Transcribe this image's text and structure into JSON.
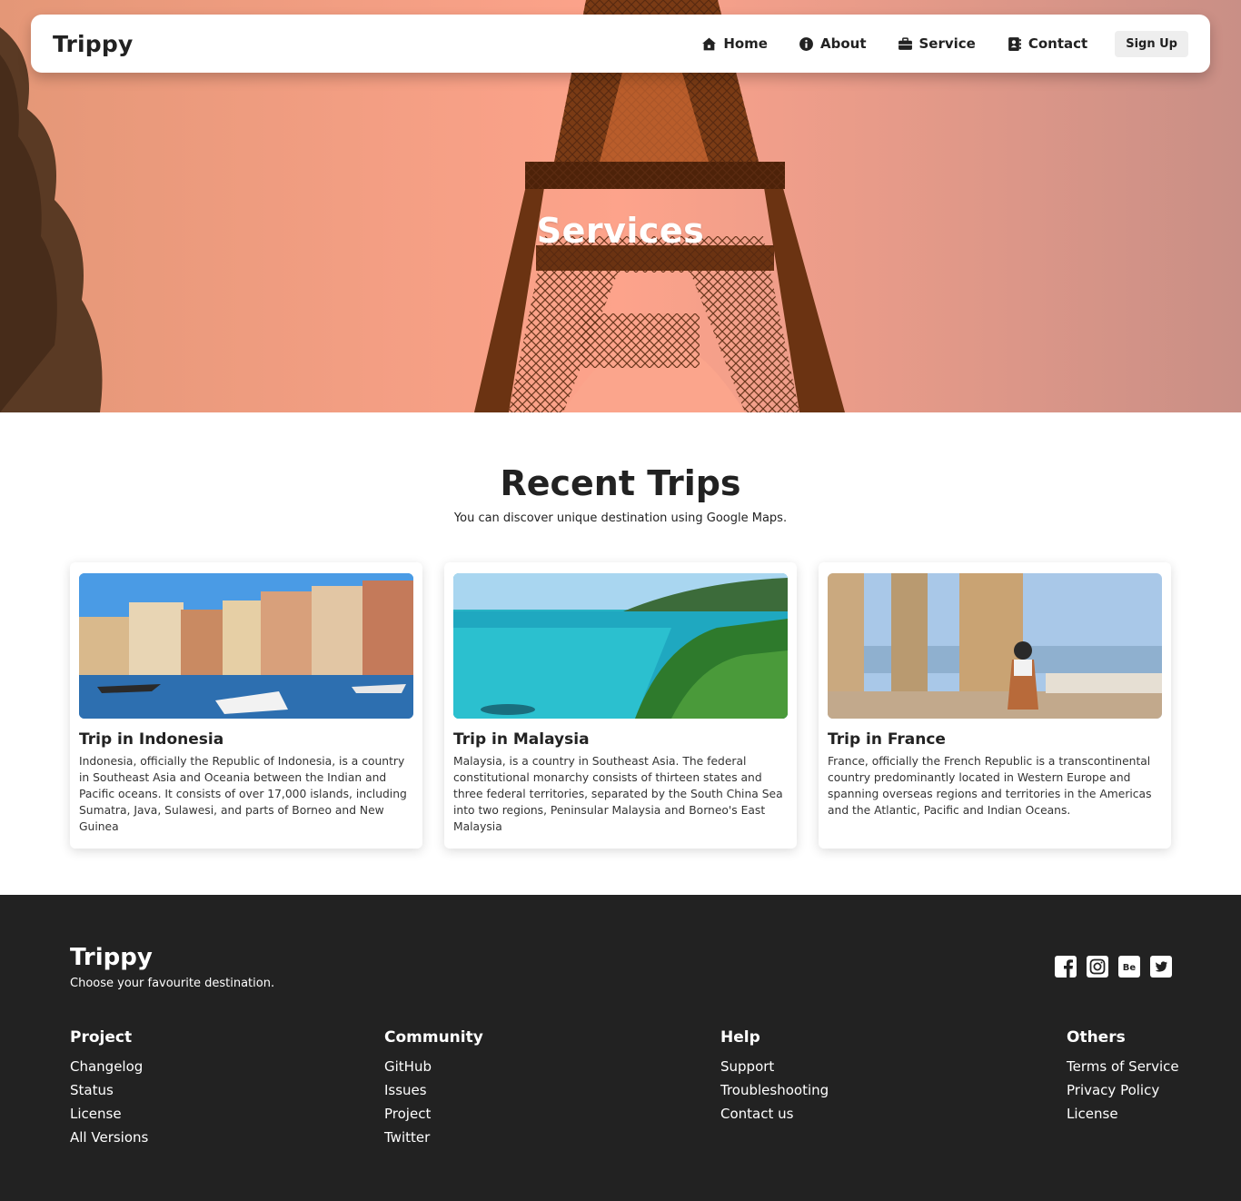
{
  "navbar": {
    "brand": "Trippy",
    "links": [
      {
        "label": "Home",
        "icon": "house-icon"
      },
      {
        "label": "About",
        "icon": "info-circle-icon"
      },
      {
        "label": "Service",
        "icon": "briefcase-icon"
      },
      {
        "label": "Contact",
        "icon": "address-book-icon"
      }
    ],
    "signup_label": "Sign Up"
  },
  "hero": {
    "title": "Services"
  },
  "trips": {
    "title": "Recent Trips",
    "subtitle": "You can discover unique destination using Google Maps.",
    "cards": [
      {
        "title": "Trip in Indonesia",
        "text": "Indonesia, officially the Republic of Indonesia, is a country in Southeast Asia and Oceania between the Indian and Pacific oceans. It consists of over 17,000 islands, including Sumatra, Java, Sulawesi, and parts of Borneo and New Guinea"
      },
      {
        "title": "Trip in Malaysia",
        "text": "Malaysia, is a country in Southeast Asia. The federal constitutional monarchy consists of thirteen states and three federal territories, separated by the South China Sea into two regions, Peninsular Malaysia and Borneo's East Malaysia"
      },
      {
        "title": "Trip in France",
        "text": "France, officially the French Republic is a transcontinental country predominantly located in Western Europe and spanning overseas regions and territories in the Americas and the Atlantic, Pacific and Indian Oceans."
      }
    ]
  },
  "footer": {
    "brand": "Trippy",
    "tagline": "Choose your favourite destination.",
    "socials": [
      "facebook-icon",
      "instagram-icon",
      "behance-icon",
      "twitter-icon"
    ],
    "columns": [
      {
        "title": "Project",
        "links": [
          "Changelog",
          "Status",
          "License",
          "All Versions"
        ]
      },
      {
        "title": "Community",
        "links": [
          "GitHub",
          "Issues",
          "Project",
          "Twitter"
        ]
      },
      {
        "title": "Help",
        "links": [
          "Support",
          "Troubleshooting",
          "Contact us"
        ]
      },
      {
        "title": "Others",
        "links": [
          "Terms of Service",
          "Privacy Policy",
          "License"
        ]
      }
    ]
  },
  "colors": {
    "footer_bg": "#222222",
    "text_dark": "#222222",
    "hero_sky": "#f7a48a",
    "button_bg": "#eeeeee"
  }
}
